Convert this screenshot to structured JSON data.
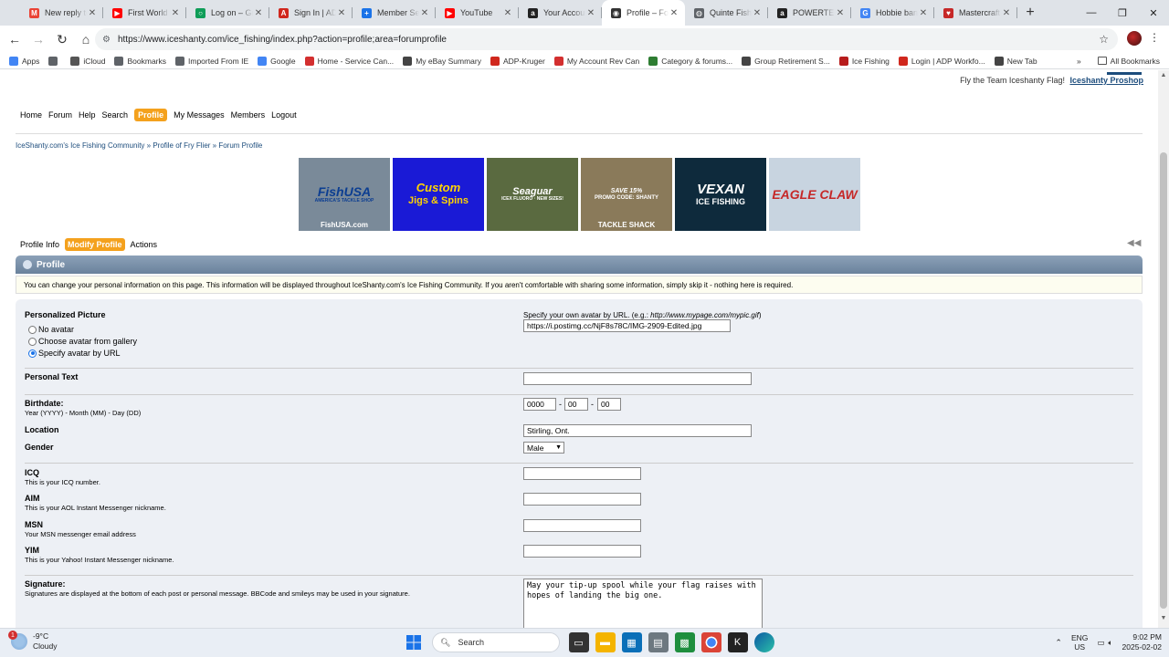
{
  "browser": {
    "tabs": [
      {
        "title": "New reply to",
        "color": "#ea4335",
        "glyph": "M"
      },
      {
        "title": "First World P",
        "color": "#ff0000",
        "glyph": "▶"
      },
      {
        "title": "Log on – Gro",
        "color": "#0f9d58",
        "glyph": "○"
      },
      {
        "title": "Sign In | ADP",
        "color": "#d0271d",
        "glyph": "A"
      },
      {
        "title": "Member Servi",
        "color": "#1a73e8",
        "glyph": "+"
      },
      {
        "title": "YouTube",
        "color": "#ff0000",
        "glyph": "▶"
      },
      {
        "title": "Your Account",
        "color": "#222222",
        "glyph": "a"
      },
      {
        "title": "Profile – Foru",
        "color": "#333333",
        "glyph": "◉",
        "active": true
      },
      {
        "title": "Quinte Fishin",
        "color": "#5f6368",
        "glyph": "◍"
      },
      {
        "title": "POWERTEC B",
        "color": "#222222",
        "glyph": "a"
      },
      {
        "title": "Hobbie band",
        "color": "#4285f4",
        "glyph": "G"
      },
      {
        "title": "Mastercraft",
        "color": "#c62828",
        "glyph": "♥"
      }
    ],
    "url": "https://www.iceshanty.com/ice_fishing/index.php?action=profile;area=forumprofile",
    "bookmarks": [
      {
        "label": "Apps",
        "color": "#4285f4"
      },
      {
        "label": "",
        "color": "#5f6368"
      },
      {
        "label": "iCloud",
        "color": "#555555"
      },
      {
        "label": "Bookmarks",
        "color": "#5f6368"
      },
      {
        "label": "Imported From IE",
        "color": "#5f6368"
      },
      {
        "label": "Google",
        "color": "#4285f4"
      },
      {
        "label": "Home - Service Can...",
        "color": "#d32f2f"
      },
      {
        "label": "My eBay Summary",
        "color": "#444444"
      },
      {
        "label": "ADP-Kruger",
        "color": "#d0271d"
      },
      {
        "label": "My Account Rev Can",
        "color": "#d32f2f"
      },
      {
        "label": "Category & forums...",
        "color": "#2e7d32"
      },
      {
        "label": "Group Retirement S...",
        "color": "#444444"
      },
      {
        "label": "Ice Fishing",
        "color": "#b71c1c"
      },
      {
        "label": "Login | ADP Workfo...",
        "color": "#d0271d"
      },
      {
        "label": "New Tab",
        "color": "#444444"
      }
    ],
    "all_bookmarks": "All Bookmarks"
  },
  "site": {
    "top_right_text": "Fly the Team Iceshanty Flag!",
    "top_right_link": "Iceshanty Proshop",
    "menu": [
      "Home",
      "Forum",
      "Help",
      "Search",
      "Profile",
      "My Messages",
      "Members",
      "Logout"
    ],
    "menu_active": "Profile",
    "breadcrumb": "IceShanty.com's Ice Fishing Community  »  Profile of Fry Flier  »  Forum Profile",
    "ads": [
      {
        "name": "FishUSA",
        "line1": "FishUSA",
        "line2": "AMERICA'S TACKLE SHOP",
        "footer": "FishUSA.com",
        "bg": "#7a8a99"
      },
      {
        "name": "Custom Jigs & Spins",
        "line1": "Custom",
        "line2": "Jigs & Spins",
        "footer": "",
        "bg": "#1a1ad6"
      },
      {
        "name": "Seaguar",
        "line1": "Seaguar",
        "line2": "ICEX FLUORO · NEW SIZES!",
        "footer": "",
        "bg": "#5a6a40"
      },
      {
        "name": "Tackle Shack",
        "line1": "SAVE 15%",
        "line2": "PROMO CODE: SHANTY",
        "footer": "TACKLE SHACK",
        "bg": "#8a7a5a"
      },
      {
        "name": "Vexan",
        "line1": "VEXAN",
        "line2": "ICE FISHING",
        "footer": "",
        "bg": "#0e2a3c"
      },
      {
        "name": "Eagle Claw",
        "line1": "EAGLE CLAW",
        "line2": "",
        "footer": "",
        "bg": "#c8d4e0"
      }
    ],
    "submenu": [
      "Profile Info",
      "Modify Profile",
      "Actions"
    ],
    "submenu_active": "Modify Profile"
  },
  "profile": {
    "header": "Profile",
    "description": "You can change your personal information on this page. This information will be displayed throughout IceShanty.com's Ice Fishing Community. If you aren't comfortable with sharing some information, simply skip it - nothing here is required.",
    "picture_label": "Personalized Picture",
    "avatar_options": [
      "No avatar",
      "Choose avatar from gallery",
      "Specify avatar by URL"
    ],
    "avatar_selected": "Specify avatar by URL",
    "avatar_url_hint": "Specify your own avatar by URL. (e.g.: ",
    "avatar_url_example": "http://www.mypage.com/mypic.gif",
    "avatar_url_hint_end": ")",
    "avatar_url": "https://i.postimg.cc/NjF8s78C/IMG-2909-Edited.jpg",
    "personal_text_label": "Personal Text",
    "personal_text": "",
    "birthdate_label": "Birthdate:",
    "birthdate_hint": "Year (YYYY) - Month (MM) - Day (DD)",
    "birth_year": "0000",
    "birth_month": "00",
    "birth_day": "00",
    "location_label": "Location",
    "location": "Stirling, Ont.",
    "gender_label": "Gender",
    "gender": "Male",
    "icq_label": "ICQ",
    "icq_hint": "This is your ICQ number.",
    "aim_label": "AIM",
    "aim_hint": "This is your AOL Instant Messenger nickname.",
    "msn_label": "MSN",
    "msn_hint": "Your MSN messenger email address",
    "yim_label": "YIM",
    "yim_hint": "This is your Yahoo! Instant Messenger nickname.",
    "signature_label": "Signature:",
    "signature_hint": "Signatures are displayed at the bottom of each post or personal message. BBCode and smileys may be used in your signature.",
    "signature": "May your tip-up spool while your flag raises with hopes of landing the big one."
  },
  "taskbar": {
    "temp": "-9°C",
    "condition": "Cloudy",
    "badge": "1",
    "search": "Search",
    "lang1": "ENG",
    "lang2": "US",
    "time": "9:02 PM",
    "date": "2025-02-02"
  }
}
